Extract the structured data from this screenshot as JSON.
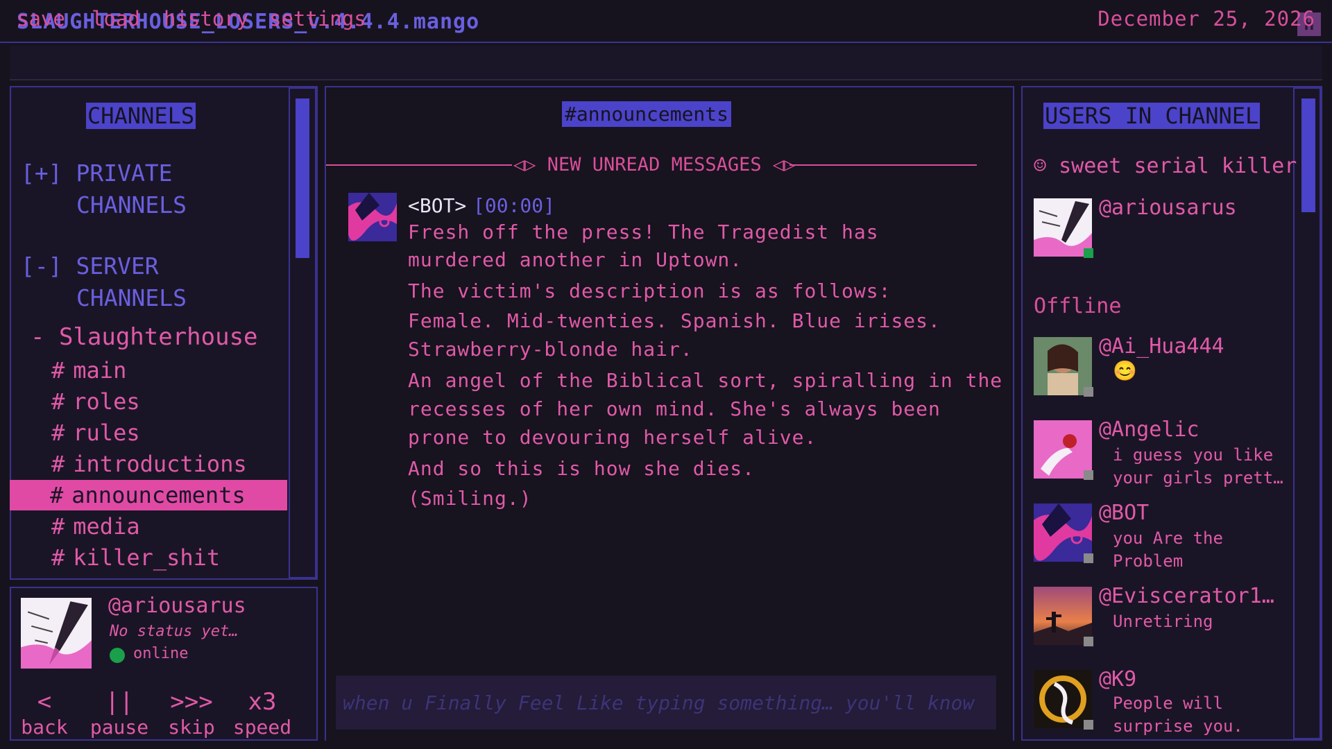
{
  "app": {
    "title": "SLAUGHTERHOUSE_LOSERS_v.4.4.4.mango",
    "window_button": "H"
  },
  "menu": {
    "items": [
      "save",
      "load",
      "history",
      "settings"
    ],
    "date": "December 25, 2026"
  },
  "sidebar": {
    "heading": "CHANNELS",
    "private_label": "[+] PRIVATE",
    "private_label2": "CHANNELS",
    "server_label": "[-] SERVER",
    "server_label2": "CHANNELS",
    "server_name": "- Slaughterhouse",
    "channels": [
      "main",
      "roles",
      "rules",
      "introductions",
      "announcements",
      "media",
      "killer_shit"
    ],
    "active_channel": "announcements"
  },
  "chat": {
    "channel_title": "#announcements",
    "unread_banner": "◁▷ NEW UNREAD MESSAGES ◁▷",
    "message": {
      "author": "<BOT>",
      "time": "[00:00]",
      "lines": [
        "Fresh off the press! The Tragedist has",
        "murdered another in Uptown.",
        "The victim's description is as follows:",
        "Female. Mid-twenties. Spanish. Blue irises.",
        "Strawberry-blonde hair.",
        "An angel of the Biblical sort, spiralling in the",
        "recesses of her own mind. She's always been",
        "prone to devouring herself alive.",
        "And so this is how she dies.",
        "(Smiling.)"
      ]
    },
    "composer_placeholder": "when u Finally Feel Like typing something… you'll know"
  },
  "users_panel": {
    "heading": "USERS IN CHANNEL",
    "group_online": "☺ sweet serial killer",
    "offline_label": "Offline",
    "online_users": [
      {
        "name": "@ariousarus",
        "status": ""
      }
    ],
    "offline_users": [
      {
        "name": "@Ai_Hua444",
        "status": "😊"
      },
      {
        "name": "@Angelic",
        "status": "i guess you like",
        "status2": "your girls prett…"
      },
      {
        "name": "@BOT",
        "status": "you Are the",
        "status2": "Problem"
      },
      {
        "name": "@Eviscerator1…",
        "status": "Unretiring"
      },
      {
        "name": "@K9",
        "status": "People will",
        "status2": "surprise you."
      }
    ]
  },
  "me": {
    "name": "@ariousarus",
    "status": "No status yet…",
    "presence": "online"
  },
  "controls": [
    {
      "icon": "<",
      "label": "back"
    },
    {
      "icon": "||",
      "label": "pause"
    },
    {
      "icon": ">>>",
      "label": "skip"
    },
    {
      "icon": "x3",
      "label": "speed"
    }
  ],
  "colors": {
    "accent_pink": "#e05aa8",
    "accent_blue": "#4b43c9",
    "background": "#16131f",
    "online": "#1aa04a"
  }
}
